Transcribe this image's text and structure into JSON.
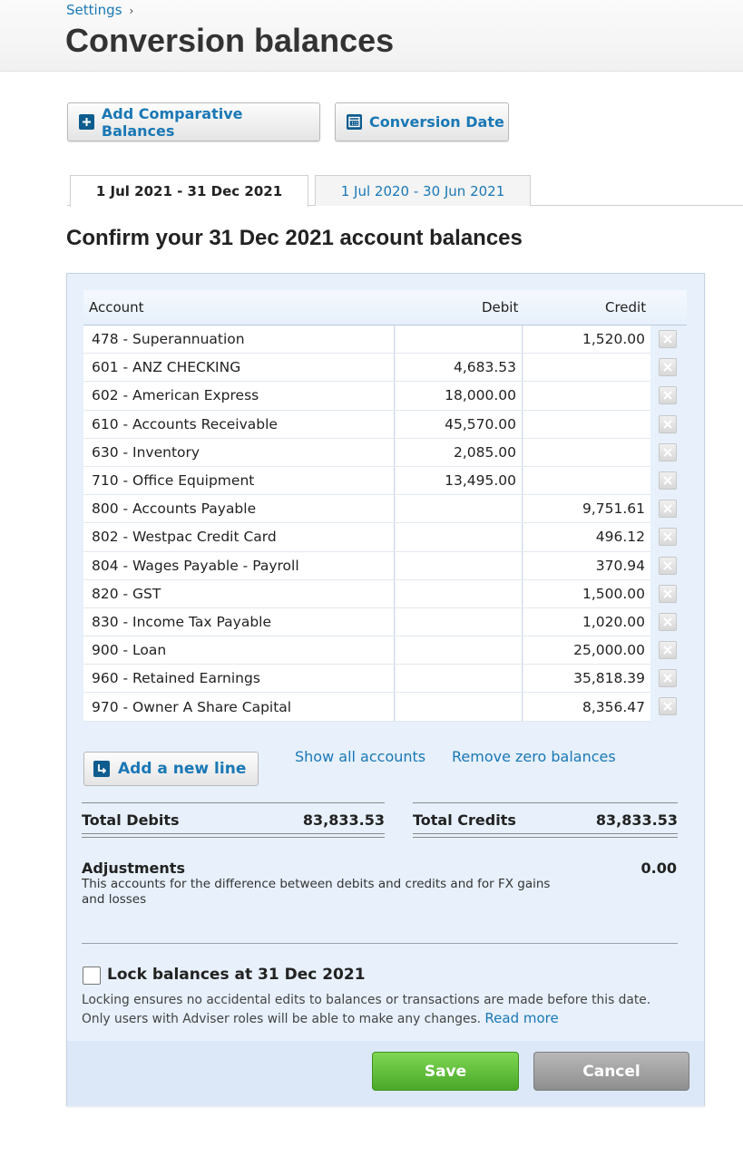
{
  "breadcrumb": {
    "parent": "Settings",
    "separator": "›"
  },
  "page": {
    "title": "Conversion balances"
  },
  "toolbar": {
    "add_comparative_label": "Add Comparative Balances",
    "conversion_date_label": "Conversion Date"
  },
  "tabs": [
    {
      "label": "1 Jul 2021 - 31 Dec 2021",
      "active": true
    },
    {
      "label": "1 Jul 2020 - 30 Jun 2021",
      "active": false
    }
  ],
  "section": {
    "title": "Confirm your 31 Dec 2021 account balances"
  },
  "table": {
    "headers": {
      "account": "Account",
      "debit": "Debit",
      "credit": "Credit"
    },
    "rows": [
      {
        "account": "478 - Superannuation",
        "debit": "",
        "credit": "1,520.00"
      },
      {
        "account": "601 - ANZ CHECKING",
        "debit": "4,683.53",
        "credit": ""
      },
      {
        "account": "602 - American Express",
        "debit": "18,000.00",
        "credit": ""
      },
      {
        "account": "610 - Accounts Receivable",
        "debit": "45,570.00",
        "credit": ""
      },
      {
        "account": "630 - Inventory",
        "debit": "2,085.00",
        "credit": ""
      },
      {
        "account": "710 - Office Equipment",
        "debit": "13,495.00",
        "credit": ""
      },
      {
        "account": "800 - Accounts Payable",
        "debit": "",
        "credit": "9,751.61"
      },
      {
        "account": "802 - Westpac Credit Card",
        "debit": "",
        "credit": "496.12"
      },
      {
        "account": "804 - Wages Payable - Payroll",
        "debit": "",
        "credit": "370.94"
      },
      {
        "account": "820 - GST",
        "debit": "",
        "credit": "1,500.00"
      },
      {
        "account": "830 - Income Tax Payable",
        "debit": "",
        "credit": "1,020.00"
      },
      {
        "account": "900 - Loan",
        "debit": "",
        "credit": "25,000.00"
      },
      {
        "account": "960 - Retained Earnings",
        "debit": "",
        "credit": "35,818.39"
      },
      {
        "account": "970 - Owner A Share Capital",
        "debit": "",
        "credit": "8,356.47"
      }
    ]
  },
  "actions": {
    "add_line_label": "Add a new line",
    "show_all_label": "Show all accounts",
    "remove_zero_label": "Remove zero balances"
  },
  "totals": {
    "debits_label": "Total Debits",
    "debits_value": "83,833.53",
    "credits_label": "Total Credits",
    "credits_value": "83,833.53"
  },
  "adjustments": {
    "label": "Adjustments",
    "description": "This accounts for the difference between debits and credits and for FX gains and losses",
    "value": "0.00"
  },
  "lock": {
    "label": "Lock balances at 31 Dec 2021",
    "checked": false,
    "description": "Locking ensures no accidental edits to balances or transactions are made before this date. Only users with Adviser roles will be able to make any changes.",
    "read_more_label": "Read more"
  },
  "footer": {
    "save_label": "Save",
    "cancel_label": "Cancel"
  },
  "colors": {
    "link": "#1a78b5",
    "panel": "#e7f0fb",
    "save": "#5cbf35",
    "cancel": "#9e9e9e"
  }
}
